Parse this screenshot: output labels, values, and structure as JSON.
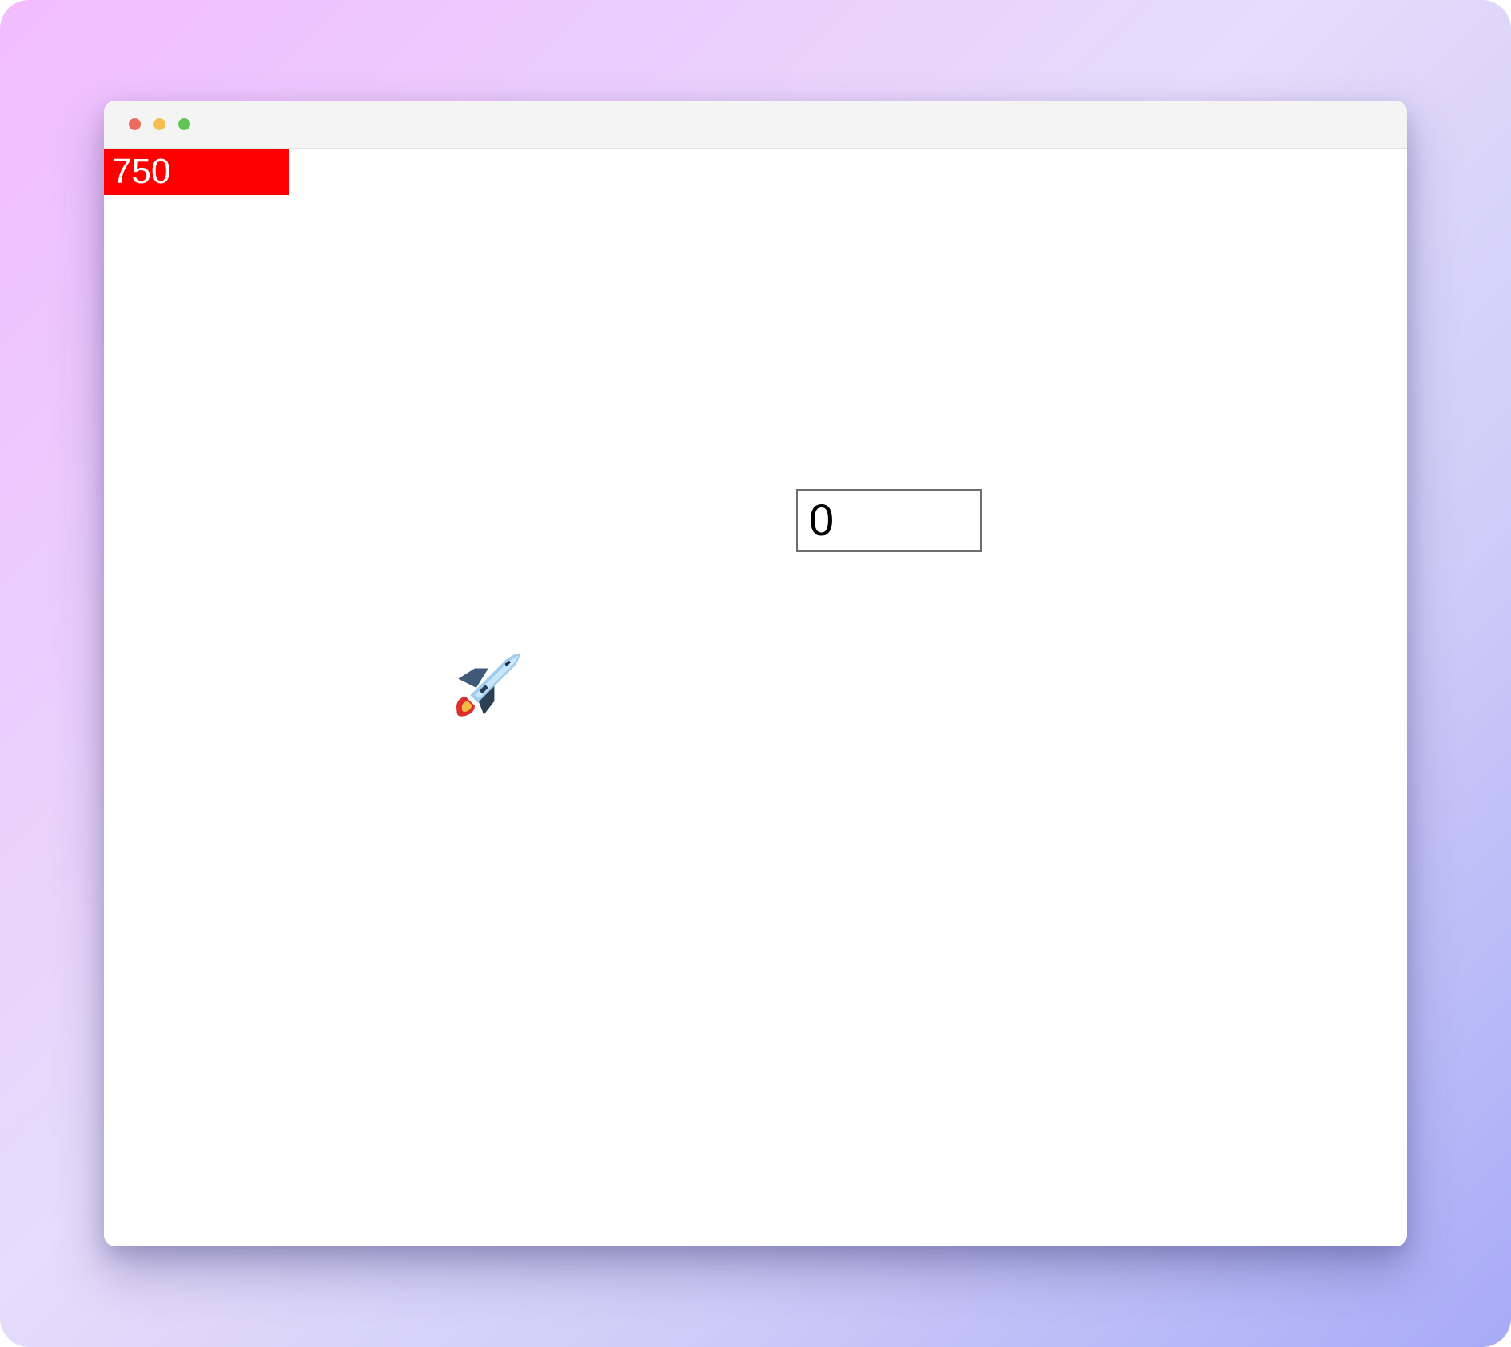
{
  "timer": {
    "value": "750",
    "background": "#ff0000",
    "text_color": "#ffffff"
  },
  "score": {
    "value": "0"
  },
  "player": {
    "icon": "rocket-icon"
  },
  "window_controls": {
    "close_color": "#ed6a5e",
    "minimize_color": "#f5be4f",
    "maximize_color": "#61c454"
  }
}
